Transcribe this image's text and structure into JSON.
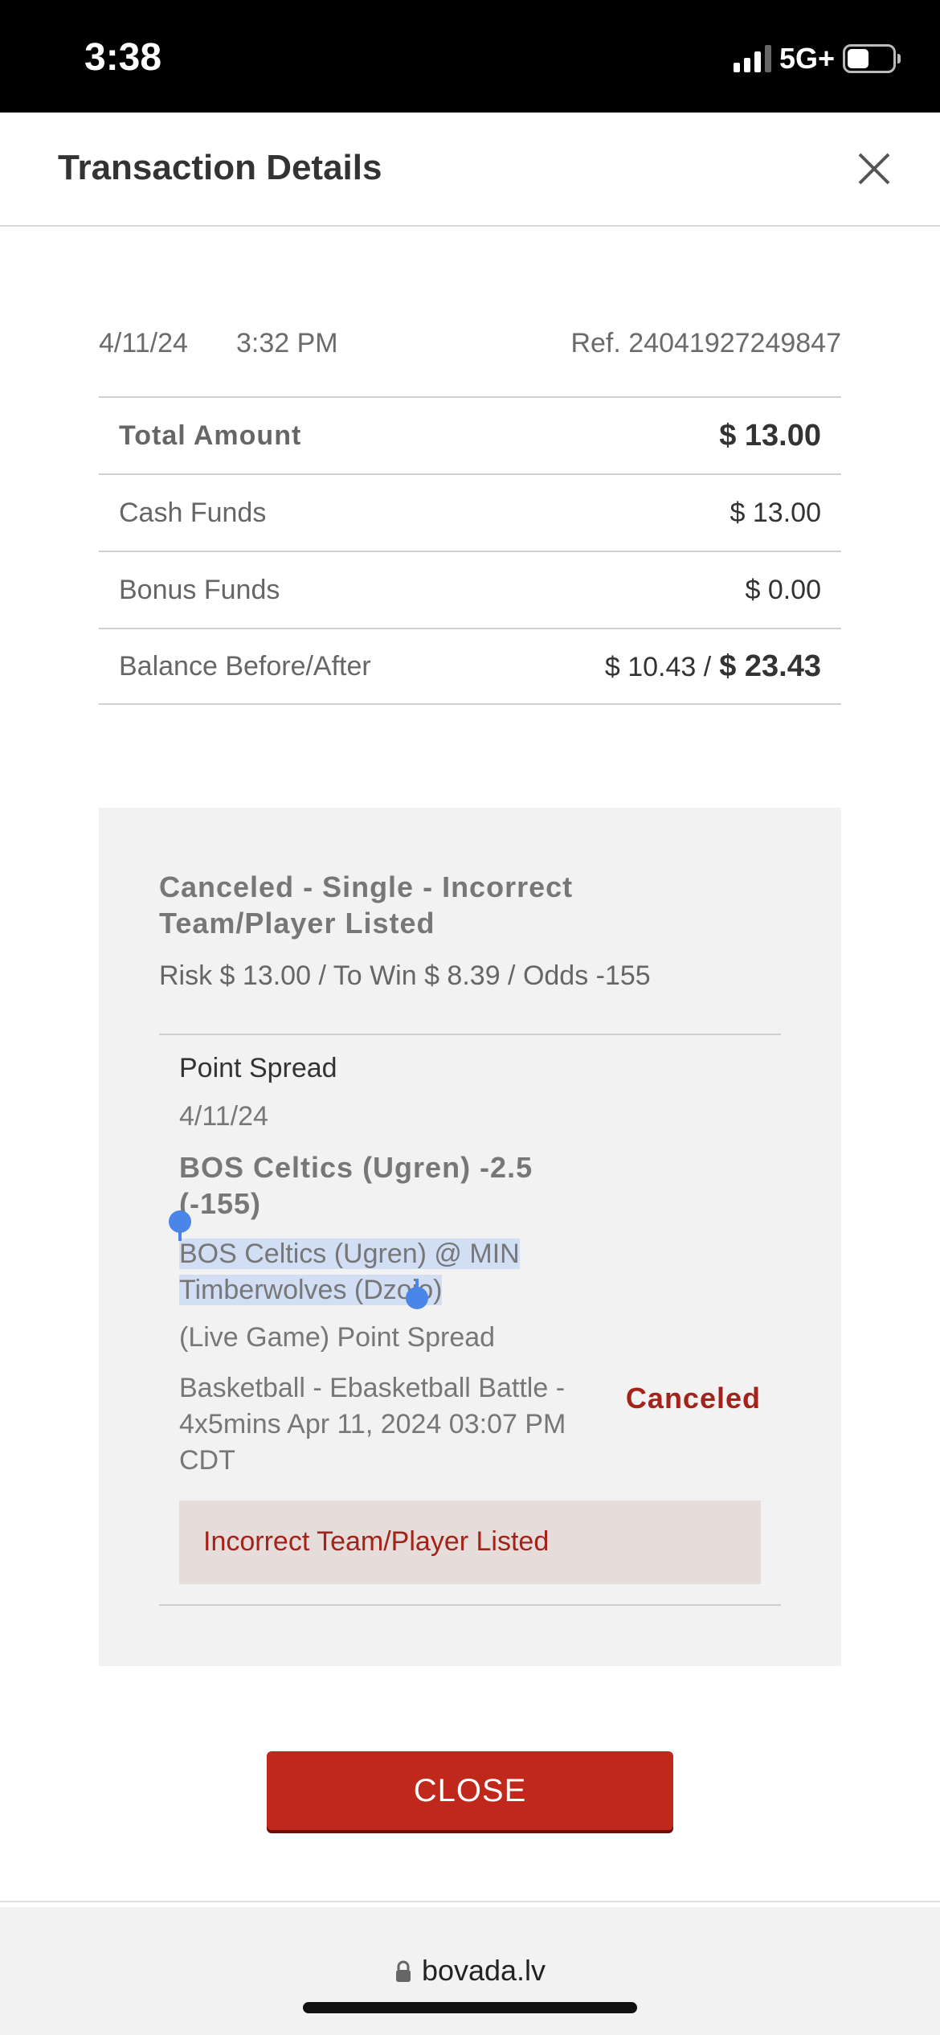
{
  "status_bar": {
    "time": "3:38",
    "network": "5G+"
  },
  "header": {
    "title": "Transaction Details"
  },
  "transaction": {
    "date": "4/11/24",
    "time": "3:32 PM",
    "ref": "Ref. 24041927249847"
  },
  "amounts": {
    "total_label": "Total Amount",
    "total_value": "$ 13.00",
    "cash_label": "Cash Funds",
    "cash_value": "$ 13.00",
    "bonus_label": "Bonus Funds",
    "bonus_value": "$ 0.00",
    "balance_label": "Balance Before/After",
    "balance_before": "$ 10.43 /",
    "balance_after": "$ 23.43"
  },
  "bet": {
    "status": "Canceled - Single - Incorrect Team/Player Listed",
    "risk_line": "Risk $ 13.00 / To Win $ 8.39 / Odds -155",
    "selection": {
      "market": "Point Spread",
      "date": "4/11/24",
      "pick": "BOS Celtics (Ugren) -2.5 (-155)",
      "match": "BOS Celtics (Ugren) @ MIN Timberwolves (Dzojo)",
      "bet_type": "(Live Game) Point Spread",
      "event": "Basketball - Ebasketball Battle - 4x5mins Apr 11, 2024 03:07 PM CDT",
      "status": "Canceled",
      "reason": "Incorrect Team/Player Listed"
    }
  },
  "close_button": {
    "label": "CLOSE"
  },
  "browser": {
    "url": "bovada.lv"
  },
  "colors": {
    "accent": "#c0281c",
    "canceled": "#a3231a",
    "highlight": "#d2def4"
  }
}
